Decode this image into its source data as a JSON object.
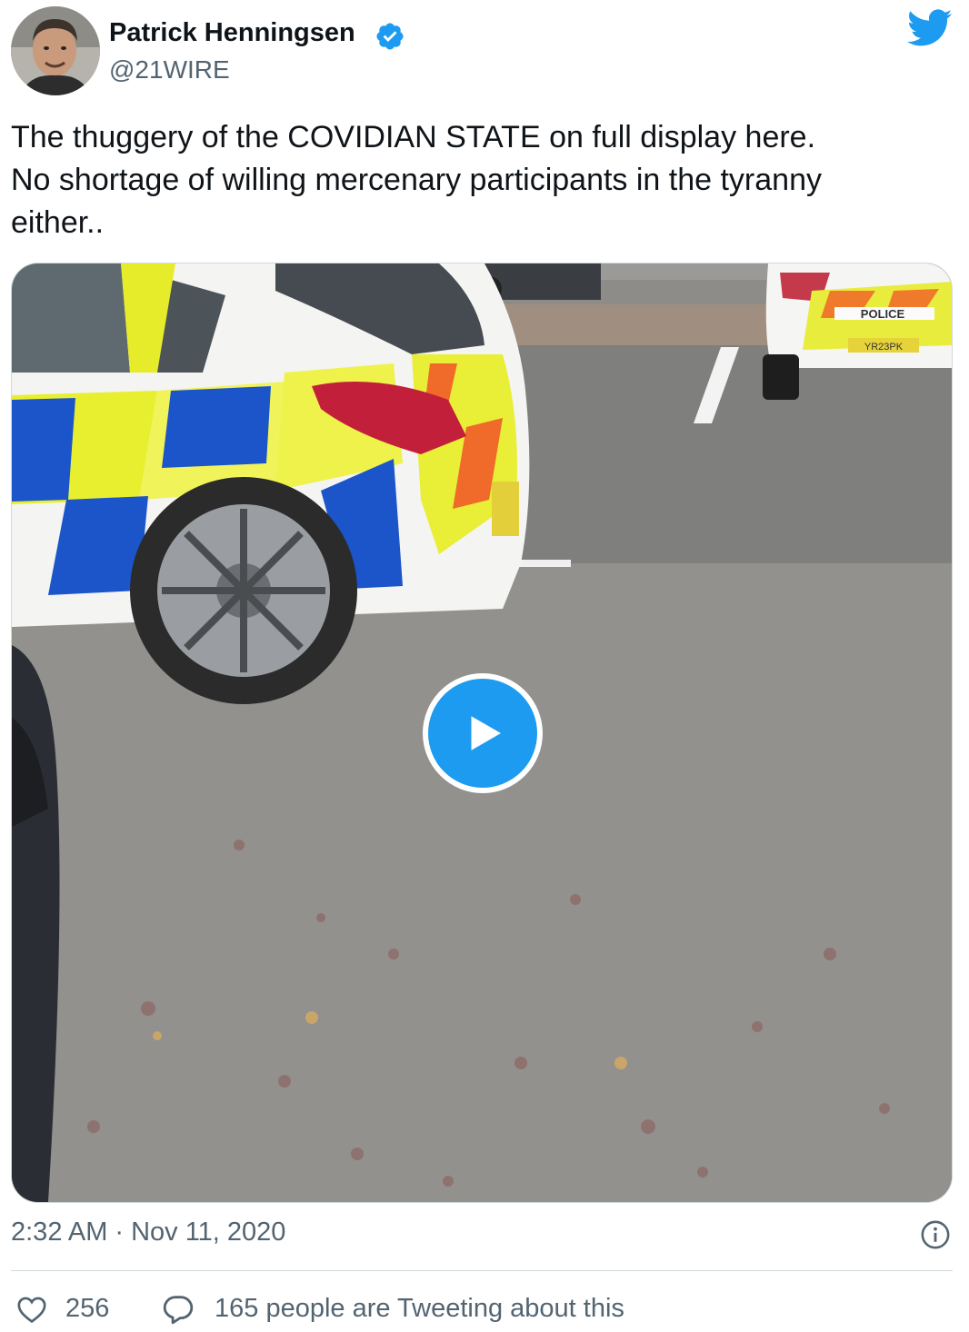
{
  "author": {
    "display_name": "Patrick Henningsen",
    "handle": "@21WIRE",
    "verified": true
  },
  "tweet": {
    "text_lines": [
      "The thuggery of the COVIDIAN STATE on full display here.",
      "No shortage of willing mercenary participants in the tyranny",
      "either.."
    ]
  },
  "media": {
    "type": "video",
    "police_marking": "POLICE",
    "plate_text": "YR23PK"
  },
  "meta": {
    "time": "2:32 AM",
    "separator": "·",
    "date": "Nov 11, 2020"
  },
  "engagement": {
    "likes": "256",
    "tweeting_text": "165 people are Tweeting about this"
  },
  "colors": {
    "brand_blue": "#1d9bf0",
    "text_primary": "#0f1419",
    "text_secondary": "#536471"
  },
  "icons": [
    "verified-badge-icon",
    "twitter-bird-icon",
    "play-icon",
    "info-icon",
    "heart-icon",
    "reply-bubble-icon"
  ]
}
